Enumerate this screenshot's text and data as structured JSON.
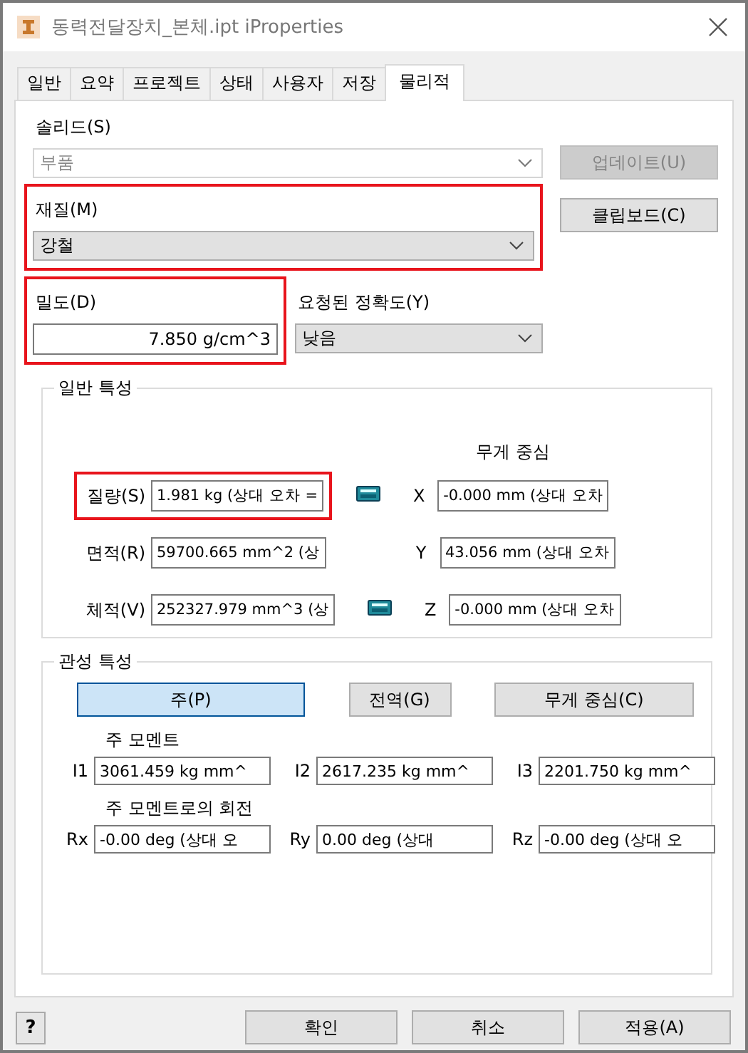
{
  "window": {
    "title": "동력전달장치_본체.ipt iProperties"
  },
  "tabs": [
    {
      "label": "일반",
      "selected": false
    },
    {
      "label": "요약",
      "selected": false
    },
    {
      "label": "프로젝트",
      "selected": false
    },
    {
      "label": "상태",
      "selected": false
    },
    {
      "label": "사용자",
      "selected": false
    },
    {
      "label": "저장",
      "selected": false
    },
    {
      "label": "물리적",
      "selected": true
    }
  ],
  "solid": {
    "label": "솔리드(S)",
    "value": "부품",
    "disabled": true
  },
  "update_button": {
    "label": "업데이트(U)",
    "disabled": true
  },
  "material": {
    "label": "재질(M)",
    "value": "강철",
    "highlighted": true
  },
  "clipboard_button": {
    "label": "클립보드(C)",
    "disabled": false
  },
  "density": {
    "label": "밀도(D)",
    "value": "7.850 g/cm^3",
    "highlighted": true
  },
  "accuracy": {
    "label": "요청된 정확도(Y)",
    "value": "낮음"
  },
  "general": {
    "title": "일반 특성",
    "center_title": "무게 중심",
    "rows": [
      {
        "label": "질량(S)",
        "value": "1.981 kg (상대 오차 =",
        "highlighted": true,
        "calculator": true,
        "axis": "X",
        "center": "-0.000 mm (상대 오차"
      },
      {
        "label": "면적(R)",
        "value": "59700.665 mm^2 (상",
        "highlighted": false,
        "calculator": false,
        "axis": "Y",
        "center": "43.056 mm (상대 오차"
      },
      {
        "label": "체적(V)",
        "value": "252327.979 mm^3 (상",
        "highlighted": false,
        "calculator": true,
        "axis": "Z",
        "center": "-0.000 mm (상대 오차"
      }
    ]
  },
  "inertia": {
    "title": "관성 특성",
    "buttons": [
      {
        "label": "주(P)",
        "selected": true
      },
      {
        "label": "전역(G)",
        "selected": false
      },
      {
        "label": "무게 중심(C)",
        "selected": false
      }
    ],
    "moments_title": "주 모멘트",
    "moments": [
      {
        "label": "I1",
        "value": "3061.459 kg mm^"
      },
      {
        "label": "I2",
        "value": "2617.235 kg mm^"
      },
      {
        "label": "I3",
        "value": "2201.750 kg mm^"
      }
    ],
    "rotation_title": "주 모멘트로의 회전",
    "rotations": [
      {
        "label": "Rx",
        "value": "-0.00 deg (상대 오"
      },
      {
        "label": "Ry",
        "value": "0.00 deg (상대"
      },
      {
        "label": "Rz",
        "value": "-0.00 deg (상대 오"
      }
    ]
  },
  "help_button": "?",
  "buttons": [
    "확인",
    "취소",
    "적용(A)"
  ]
}
